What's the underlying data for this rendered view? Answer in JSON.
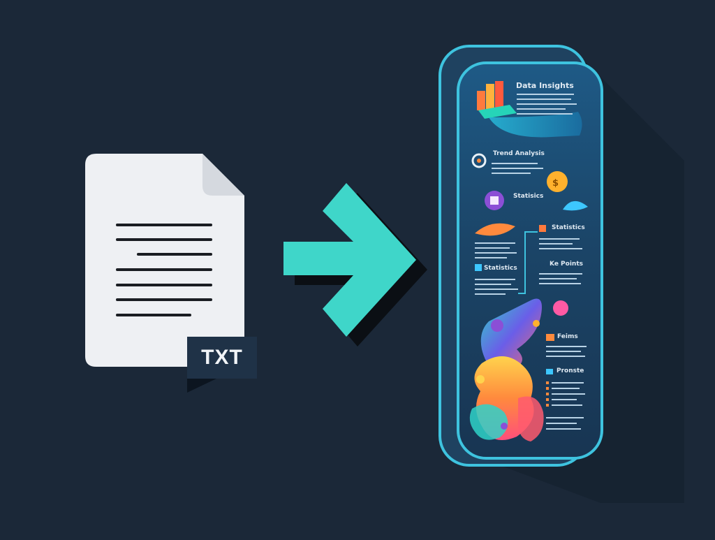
{
  "document": {
    "badge": "TXT"
  },
  "infographic": {
    "title": "Data Insights",
    "sections": [
      {
        "label": "Trend Analysis"
      },
      {
        "label": "Statisics"
      },
      {
        "label": "Statistics"
      },
      {
        "label": "Ke Points"
      },
      {
        "label": "Statistics"
      },
      {
        "label": "Feims"
      },
      {
        "label": "Pronste"
      }
    ]
  },
  "colors": {
    "background": "#1b2838",
    "arrow": "#3fd6c9",
    "panel_border": "#3ec3df",
    "document": "#eef0f3"
  }
}
